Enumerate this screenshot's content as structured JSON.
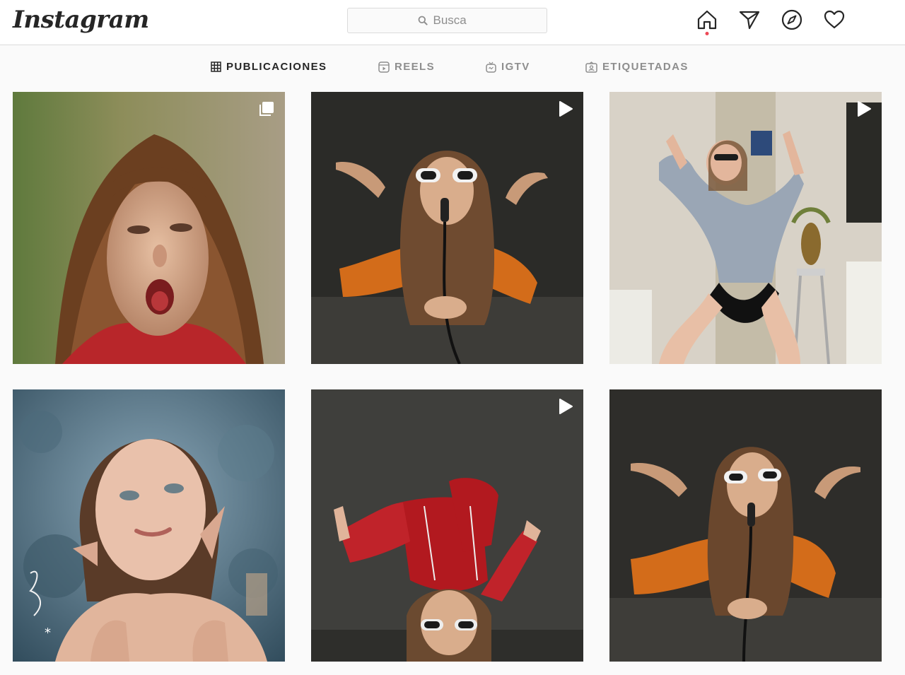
{
  "header": {
    "logo": "Instagram",
    "search_placeholder": "Busca"
  },
  "nav": {
    "icons": [
      "home-icon",
      "direct-message-icon",
      "explore-icon",
      "activity-heart-icon"
    ],
    "notification_color": "#ed4956"
  },
  "tabs": [
    {
      "label": "PUBLICACIONES",
      "icon": "grid-icon",
      "active": true
    },
    {
      "label": "REELS",
      "icon": "reels-icon",
      "active": false
    },
    {
      "label": "IGTV",
      "icon": "igtv-icon",
      "active": false
    },
    {
      "label": "ETIQUETADAS",
      "icon": "tagged-icon",
      "active": false
    }
  ],
  "posts": [
    {
      "type": "carousel",
      "badge_icon": "carousel-icon"
    },
    {
      "type": "video",
      "badge_icon": "play-icon"
    },
    {
      "type": "video",
      "badge_icon": "play-icon"
    },
    {
      "type": "photo",
      "badge_icon": ""
    },
    {
      "type": "video",
      "badge_icon": "play-icon"
    },
    {
      "type": "photo",
      "badge_icon": ""
    }
  ],
  "colors": {
    "background": "#fafafa",
    "border": "#dbdbdb",
    "text_primary": "#262626",
    "text_secondary": "#8e8e8e"
  }
}
